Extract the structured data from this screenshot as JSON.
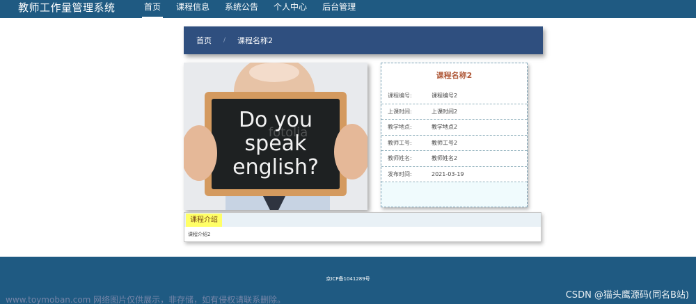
{
  "header": {
    "brand": "教师工作量管理系统",
    "nav": [
      {
        "label": "首页",
        "active": true
      },
      {
        "label": "课程信息"
      },
      {
        "label": "系统公告"
      },
      {
        "label": "个人中心"
      },
      {
        "label": "后台管理"
      }
    ]
  },
  "breadcrumb": {
    "home": "首页",
    "separator": "/",
    "current": "课程名称2"
  },
  "photo": {
    "text_line1": "Do you",
    "text_line2": "speak",
    "text_line3": "english?",
    "watermark": "fotolia"
  },
  "detail": {
    "title": "课程名称2",
    "rows": [
      {
        "label": "课程编号:",
        "value": "课程编号2"
      },
      {
        "label": "上课时间:",
        "value": "上课时间2"
      },
      {
        "label": "教学地点:",
        "value": "教学地点2"
      },
      {
        "label": "教师工号:",
        "value": "教师工号2"
      },
      {
        "label": "教师姓名:",
        "value": "教师姓名2"
      },
      {
        "label": "发布时间:",
        "value": "2021-03-19"
      }
    ]
  },
  "intro": {
    "tab": "课程介绍",
    "content": "课程介绍2"
  },
  "footer": {
    "icp": "京ICP备1041289号",
    "watermark_left": "www.toymoban.com 网络图片仅供展示，非存储，如有侵权请联系删除。",
    "watermark_right": "CSDN @猫头鹰源码(同名B站)"
  },
  "colors": {
    "nav_bg": "#1f5a82",
    "crumb_bg": "#2f4f7f",
    "title_accent": "#b05a3a",
    "tab_highlight": "#ffff66"
  }
}
